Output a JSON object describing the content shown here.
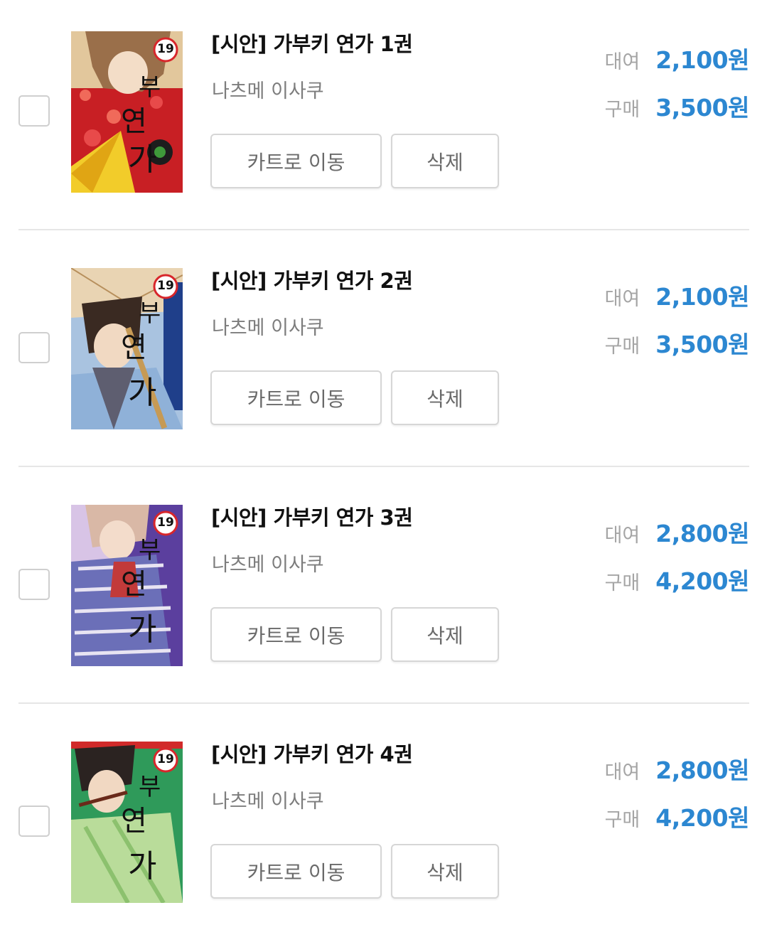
{
  "accent_color": "#2c87d1",
  "items": [
    {
      "title": "[시안] 가부키 연가 1권",
      "author": "나츠메 이사쿠",
      "cart_button": "카트로 이동",
      "delete_button": "삭제",
      "rent_label": "대여",
      "rent_price": "2,100원",
      "buy_label": "구매",
      "buy_price": "3,500원",
      "cover_badge": "19"
    },
    {
      "title": "[시안] 가부키 연가 2권",
      "author": "나츠메 이사쿠",
      "cart_button": "카트로 이동",
      "delete_button": "삭제",
      "rent_label": "대여",
      "rent_price": "2,100원",
      "buy_label": "구매",
      "buy_price": "3,500원",
      "cover_badge": "19"
    },
    {
      "title": "[시안] 가부키 연가 3권",
      "author": "나츠메 이사쿠",
      "cart_button": "카트로 이동",
      "delete_button": "삭제",
      "rent_label": "대여",
      "rent_price": "2,800원",
      "buy_label": "구매",
      "buy_price": "4,200원",
      "cover_badge": "19"
    },
    {
      "title": "[시안] 가부키 연가 4권",
      "author": "나츠메 이사쿠",
      "cart_button": "카트로 이동",
      "delete_button": "삭제",
      "rent_label": "대여",
      "rent_price": "2,800원",
      "buy_label": "구매",
      "buy_price": "4,200원",
      "cover_badge": "19"
    }
  ]
}
